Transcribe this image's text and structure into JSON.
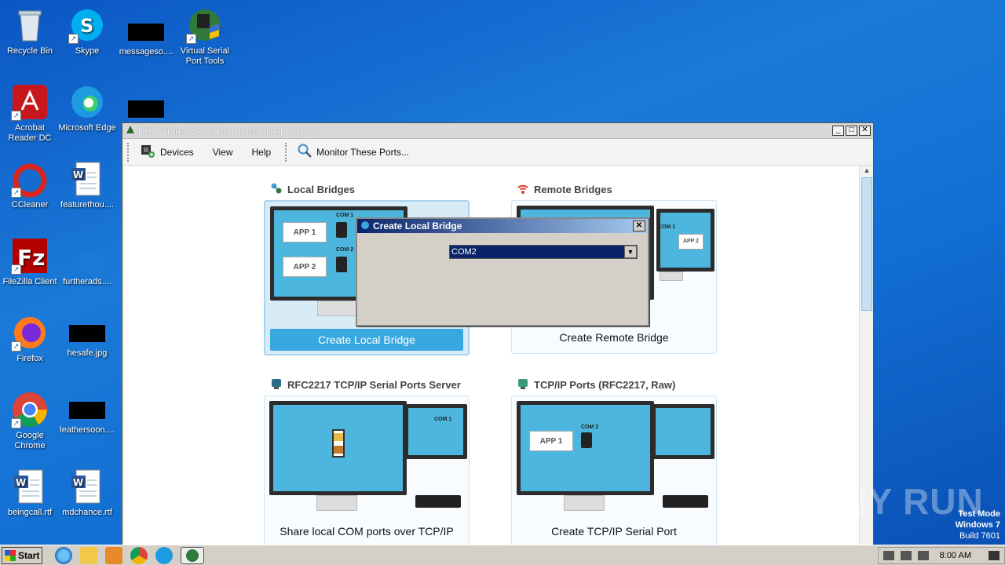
{
  "desktop": {
    "icons": [
      {
        "label": "Recycle Bin",
        "icon": "recycle-bin-icon"
      },
      {
        "label": "Skype",
        "icon": "skype-icon"
      },
      {
        "label": "messageso....",
        "icon": "redacted-file-icon"
      },
      {
        "label": "Virtual Serial Port Tools",
        "icon": "serial-port-tools-icon"
      },
      {
        "label": "Acrobat Reader DC",
        "icon": "acrobat-icon"
      },
      {
        "label": "Microsoft Edge",
        "icon": "edge-icon"
      },
      {
        "label": "CCleaner",
        "icon": "ccleaner-icon"
      },
      {
        "label": "featurethou....",
        "icon": "word-doc-icon"
      },
      {
        "label": "FileZilla Client",
        "icon": "filezilla-icon"
      },
      {
        "label": "furtherads....",
        "icon": "file-icon"
      },
      {
        "label": "Firefox",
        "icon": "firefox-icon"
      },
      {
        "label": "hesafe.jpg",
        "icon": "image-file-icon"
      },
      {
        "label": "Google Chrome",
        "icon": "chrome-icon"
      },
      {
        "label": "leathersoon....",
        "icon": "file-icon"
      },
      {
        "label": "beingcall.rtf",
        "icon": "word-doc-icon"
      },
      {
        "label": "mdchance.rtf",
        "icon": "word-doc-icon"
      }
    ]
  },
  "window": {
    "title": "HHD Virtual Serial Port Tools (Trial Version)",
    "controls": {
      "minimize": "_",
      "maximize": "□",
      "close": "✕"
    },
    "toolbar": {
      "devices": "Devices",
      "view": "View",
      "help": "Help",
      "monitor": "Monitor These Ports..."
    },
    "sections": {
      "local_bridges": "Local Bridges",
      "remote_bridges": "Remote Bridges",
      "rfc2217_server": "RFC2217 TCP/IP Serial Ports Server",
      "tcpip_ports": "TCP/IP Ports (RFC2217, Raw)"
    },
    "cards": {
      "local_bridge_button": "Create Local Bridge",
      "remote_bridge_label": "Create Remote Bridge",
      "share_label": "Share local COM ports over TCP/IP",
      "tcpip_label": "Create TCP/IP Serial Port"
    },
    "illustration_labels": {
      "app1": "APP 1",
      "app2": "APP 2",
      "com1": "COM 1",
      "com2": "COM 2"
    }
  },
  "dialog": {
    "title": "Create Local Bridge",
    "combo_value": "COM2",
    "close": "✕"
  },
  "taskbar": {
    "start": "Start",
    "clock": "8:00 AM"
  },
  "overlay": {
    "watermark": "ANY RUN",
    "test_mode": "Test Mode",
    "os": "Windows 7",
    "build": "Build 7601"
  },
  "colors": {
    "accent": "#3aa8e0",
    "dialog_title": "#0a246a",
    "desktop": "#1270d4"
  }
}
